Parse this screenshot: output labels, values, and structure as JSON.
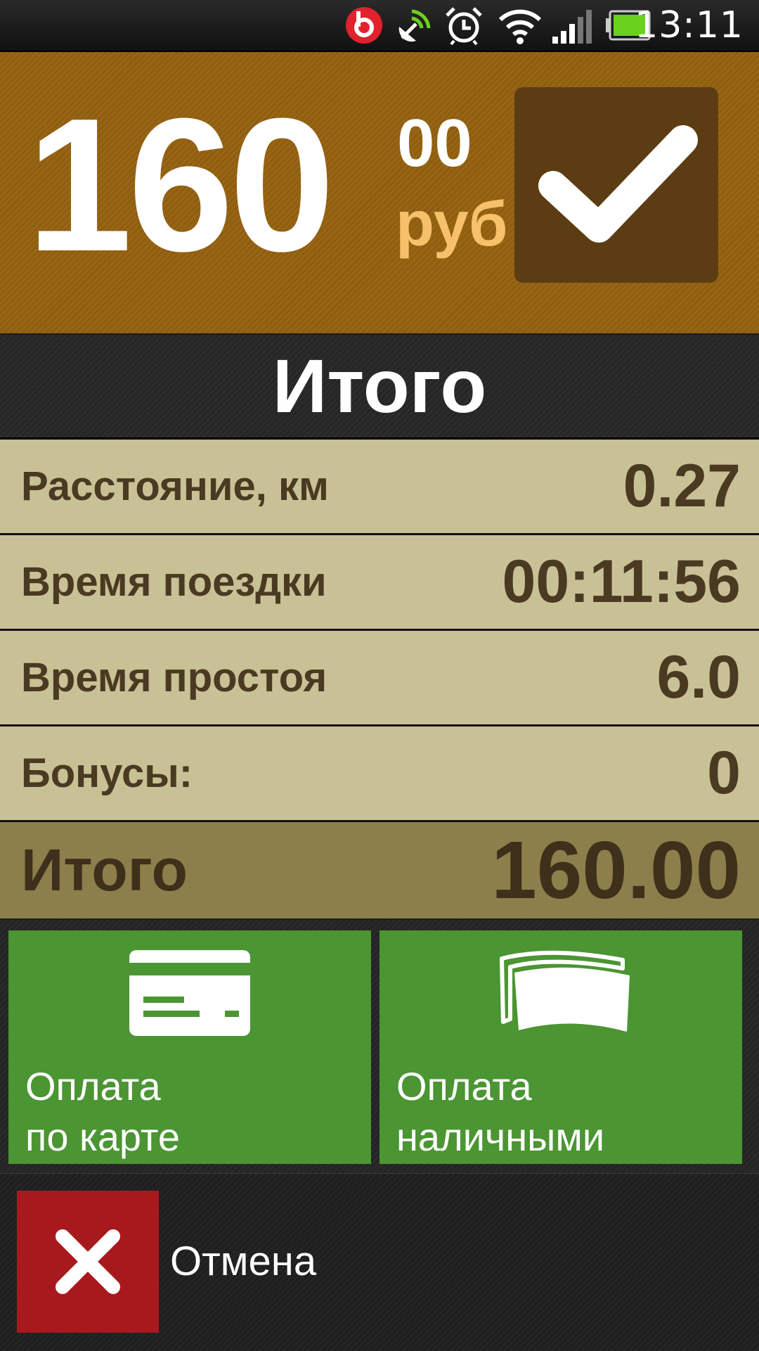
{
  "status_bar": {
    "time": "13:11",
    "icons": [
      "beats-audio-icon",
      "gps-icon",
      "alarm-clock-icon",
      "wifi-icon",
      "signal-icon",
      "battery-icon"
    ],
    "battery_color": "#6ad11f",
    "beats_color": "#e0212e"
  },
  "header": {
    "amount_whole": "160",
    "amount_cents": "00",
    "currency": "руб",
    "confirm_icon": "checkmark-icon"
  },
  "title": "Итого",
  "rows": [
    {
      "label": "Расстояние, км",
      "value": "0.27"
    },
    {
      "label": "Время поездки",
      "value": "00:11:56"
    },
    {
      "label": "Время простоя",
      "value": "6.0"
    },
    {
      "label": "Бонусы:",
      "value": "0"
    }
  ],
  "total": {
    "label": "Итого",
    "value": "160.00"
  },
  "payment": {
    "card": {
      "line1": "Оплата",
      "line2": "по карте",
      "icon": "credit-card-icon"
    },
    "cash": {
      "line1": "Оплата",
      "line2": "наличными",
      "icon": "cash-bills-icon"
    }
  },
  "cancel": {
    "label": "Отмена",
    "icon": "close-icon"
  },
  "colors": {
    "header_bg": "#94600f",
    "confirm_bg": "#5c3c12",
    "currency": "#f7c06a",
    "row_bg": "#c9c196",
    "total_bg": "#8c7f4b",
    "pay_green": "#4b9533",
    "cancel_red": "#a8191e"
  }
}
